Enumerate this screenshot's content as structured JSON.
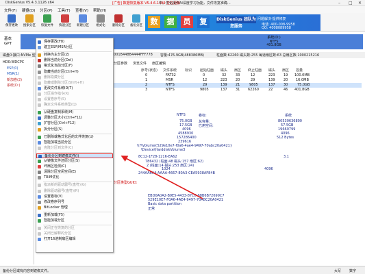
{
  "titlebar": {
    "title": "DiskGenius V5.4.3.1126 x64",
    "ad": "[广告] 数据恢复版本 V5.4.6.1499 正在更新",
    "ad_tail": "中，优化操作AI深度学习功能，文件恢复准确..."
  },
  "menubar": [
    "文件(F)",
    "硬盘(D)",
    "分区(P)",
    "工具(T)",
    "查看(V)",
    "帮助(H)"
  ],
  "toolbar": [
    {
      "label": "保存更改",
      "color": "#3a6fc8"
    },
    {
      "label": "搜索分区",
      "color": "#e0a020"
    },
    {
      "label": "恢复文件",
      "color": "#3aa050"
    },
    {
      "label": "快速分区",
      "color": "#d04040"
    },
    {
      "label": "新建分区",
      "color": "#5a8ae0"
    },
    {
      "label": "格式化",
      "color": "#8a8a8a"
    },
    {
      "label": "删除分区",
      "color": "#c03030"
    },
    {
      "label": "备份分区",
      "color": "#40a0d0"
    }
  ],
  "banner": {
    "blocks": [
      {
        "char": "数",
        "color": "#e8a020"
      },
      {
        "char": "据",
        "color": "#40b040"
      },
      {
        "char": "员",
        "color": "#e04040"
      },
      {
        "char": "复",
        "color": "#2070d0"
      }
    ],
    "brand": "DiskGenius 团队为您服务",
    "tagline": "问题解决·提供修复",
    "phone": "电话: 400-008-9958",
    "qq": "QQ: 4008089958"
  },
  "diskbar": {
    "label_line1": "基本",
    "label_line2": "GPT",
    "system_name": "系统(D:)",
    "system_fs": "NTFS",
    "system_size": "401.8GB"
  },
  "diskinfo": {
    "left": "磁盘0:接口:NVMe 型号:",
    "mid": "容量:476.9GB(488386MB)",
    "right": "柱面数:62260 磁头数:255 每道扇区数:63 总扇区数:1000215216",
    "serial": "001B448B4444FFF778"
  },
  "tree": [
    {
      "label": "HD0:WDCPC",
      "color": "#111"
    },
    {
      "label": "ESP(0)",
      "color": "#2a60c0"
    },
    {
      "label": "MSR(1)",
      "color": "#2a60c0"
    },
    {
      "label": "新加卷(2)",
      "color": "#c03030"
    },
    {
      "label": "系统(D:)",
      "color": "#c03030"
    }
  ],
  "tabs": [
    "分区参数",
    "浏览文件",
    "扇区编辑"
  ],
  "ptable": {
    "headers": [
      "序号(状态)",
      "文件系统",
      "标识",
      "起始柱面",
      "磁头",
      "扇区",
      "终止柱面",
      "磁头",
      "扇区",
      "容量"
    ],
    "rows": [
      [
        "0",
        "FAT32",
        "",
        "0",
        "32",
        "33",
        "12",
        "223",
        "19",
        "100.0MB"
      ],
      [
        "1",
        "MSR",
        "",
        "12",
        "223",
        "20",
        "29",
        "139",
        "20",
        "16.0MB"
      ],
      [
        "2",
        "NTFS",
        "",
        "29",
        "139",
        "21",
        "9805",
        "137",
        "30",
        "75.0GB"
      ],
      [
        "3",
        "NTFS",
        "",
        "9805",
        "137",
        "31",
        "62260",
        "22",
        "46",
        "401.8GB"
      ]
    ]
  },
  "details": {
    "fs_type": "NTFS",
    "vol_label_key": "卷标:",
    "vol_label_val": "系统",
    "total_size_key": "总容量:",
    "total_size": "75.0GB",
    "total_bytes": "80530636800",
    "used_key": "已用空间:",
    "used": "17.5GB",
    "free": "57.5GB",
    "cluster": "4096",
    "total_clusters": "19660799",
    "free_clusters": "4588930",
    "sectors": "157286400",
    "sector_size": "512 Bytes",
    "first_sector": "239616",
    "volume_path": "\\\\?\\Volume{529e10e7-f0a6-4ae4-9497-70abc20a0421}",
    "device_path": "\\Device\\HarddiskVolume3",
    "ntfs_ver": "3.1",
    "serial": "8C12-1F28-1216-EA62",
    "mft_pos": "786432 (柱面:48 磁头:157 扇区:62)",
    "mftmirr_pos": "2 (柱面:14 磁头:253 扇区:24)",
    "file_record": "1024",
    "index_record": "4096",
    "guid": "244AA6A4-AAAA-4667-80A3-CEA5938AF84B",
    "analysis_label": "分区类型GUID:",
    "part_guid": "EBD0A0A2-B9E5-4433-87C0-68B6B72699C7",
    "part_uuid": "529E10E7-F0A6-4AE4-9497-70ABC20A0421",
    "part_name": "Basic data partition",
    "part_attr": "正常"
  },
  "ctxmenu": [
    {
      "label": "保存更改(F8)",
      "disabled": false,
      "color": "#3a6fc8"
    },
    {
      "label": "建立ESP/MSR分区",
      "disabled": false,
      "color": "#6a9ae0"
    },
    {
      "label": "转换为主分区(Z)",
      "disabled": false,
      "color": "#e0a020"
    },
    {
      "label": "删除当前分区(Del)",
      "disabled": false,
      "color": "#c03030"
    },
    {
      "label": "格式化当前分区(F)",
      "disabled": false,
      "color": "#808080"
    },
    {
      "label": "隐藏当前分区(Ctrl+H)",
      "disabled": false,
      "color": "#909090"
    },
    {
      "label": "删除隐藏分区",
      "disabled": true,
      "color": "#c8c8c8"
    },
    {
      "label": "隐藏或删除分区(Shift+H)",
      "disabled": true,
      "color": "#c8c8c8"
    },
    {
      "label": "更改文件系统ID(T)",
      "disabled": false,
      "color": "#5a8ae0"
    },
    {
      "label": "分区操作指令(K)",
      "disabled": true,
      "color": "#c8c8c8"
    },
    {
      "label": "设置卷序号(S)",
      "disabled": true,
      "color": "#c8c8c8"
    },
    {
      "label": "确定文件系统类型(Q)",
      "disabled": true,
      "color": "#c8c8c8"
    },
    {
      "label": "从硬盘复制系统(M)",
      "disabled": false,
      "color": "#3aa050"
    },
    {
      "label": "调整分区大小(Ctrl+F11)",
      "disabled": false,
      "color": "#3a6fc8"
    },
    {
      "label": "扩容分区(Ctrl+F12)",
      "disabled": false,
      "color": "#40a0d0"
    },
    {
      "label": "拆分分区(S)",
      "disabled": false,
      "color": "#e0a020"
    },
    {
      "label": "已删除或格式化后的文件恢复(U)",
      "disabled": false,
      "color": "#3aa050"
    },
    {
      "label": "智能加载当前分区",
      "disabled": false,
      "color": "#5a8ae0"
    },
    {
      "label": "克隆分区到文件(C)",
      "disabled": true,
      "color": "#c8c8c8"
    },
    {
      "label": "备份分区到镜像文件(I)",
      "disabled": false,
      "color": "#2a60c0"
    },
    {
      "label": "从镜像文件还原分区(S)",
      "disabled": false,
      "color": "#3aa050"
    },
    {
      "label": "坏扇区检测(C)",
      "disabled": false,
      "color": "#e04040"
    },
    {
      "label": "清除分区空闲空间(E)",
      "disabled": false,
      "color": "#808080"
    },
    {
      "label": "TRIM优化",
      "disabled": false,
      "color": "#909090"
    },
    {
      "label": "指派新的驱动器号(盘符)(G)",
      "disabled": true,
      "color": "#c8c8c8"
    },
    {
      "label": "删除驱动器号(盘符)(R)",
      "disabled": true,
      "color": "#c8c8c8"
    },
    {
      "label": "设置卷标(V)",
      "disabled": false,
      "color": "#5a8ae0"
    },
    {
      "label": "修改卷序列号",
      "disabled": false,
      "color": "#909090"
    },
    {
      "label": "BitLocker 管理",
      "disabled": false,
      "color": "#e0a020"
    },
    {
      "label": "重新加载(F5)",
      "disabled": false,
      "color": "#3a6fc8"
    },
    {
      "label": "智能加载分区",
      "disabled": false,
      "color": "#3aa050"
    },
    {
      "label": "关闭正在恢复的分区",
      "disabled": true,
      "color": "#c8c8c8"
    },
    {
      "label": "关闭已解释的分区",
      "disabled": true,
      "color": "#c8c8c8"
    },
    {
      "label": "打开16进制扇区编辑",
      "disabled": false,
      "color": "#5a8ae0"
    }
  ],
  "highlight_index": 19,
  "statusbar": {
    "left": "备份分区或有内容到镜像文件。",
    "caps": "大写",
    "num": "数字"
  }
}
